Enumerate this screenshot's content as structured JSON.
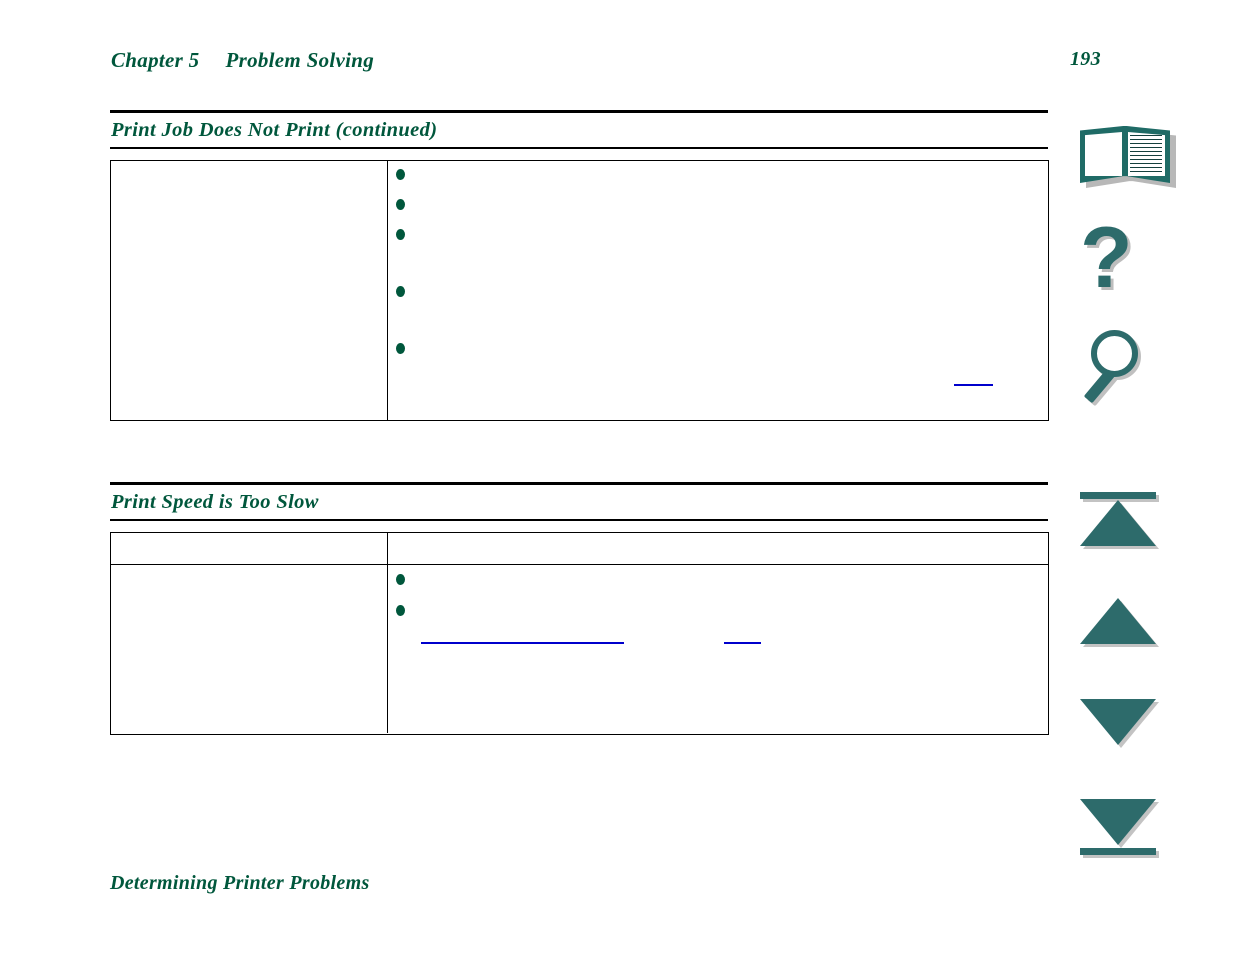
{
  "document": {
    "header": {
      "chapter_label": "Chapter 5",
      "chapter_title": "Problem Solving",
      "page_number": "193"
    },
    "footer": {
      "link_label": "Determining Printer Problems"
    },
    "sections": [
      {
        "id": "print-job-does-not-print",
        "title": "Print Job Does Not Print (continued)",
        "table": {
          "has_header_row": false,
          "left_column_cells": [
            ""
          ],
          "right_column_bullets": [
            "",
            "",
            "",
            "",
            ""
          ],
          "right_column_links": [
            ""
          ]
        }
      },
      {
        "id": "print-speed-is-too-slow",
        "title": "Print Speed is Too Slow",
        "table": {
          "has_header_row": true,
          "header_cells": [
            "",
            ""
          ],
          "left_column_cells": [
            ""
          ],
          "right_column_bullets": [
            "",
            ""
          ],
          "right_column_links": [
            "",
            ""
          ]
        }
      }
    ]
  },
  "nav_rail": {
    "buttons": [
      {
        "id": "contents",
        "icon": "book-icon",
        "label": "Contents"
      },
      {
        "id": "index",
        "icon": "question-mark-icon",
        "label": "Index / Help"
      },
      {
        "id": "search",
        "icon": "magnifier-icon",
        "label": "Search"
      },
      {
        "id": "first-page",
        "icon": "first-page-arrow-icon",
        "label": "First page"
      },
      {
        "id": "previous-page",
        "icon": "previous-page-arrow-icon",
        "label": "Previous page"
      },
      {
        "id": "next-page",
        "icon": "next-page-arrow-icon",
        "label": "Next page"
      },
      {
        "id": "last-page",
        "icon": "last-page-arrow-icon",
        "label": "Last page"
      }
    ]
  },
  "colors": {
    "heading_green": "#00573c",
    "bullet_green": "#00573c",
    "link_blue": "#0000cc",
    "icon_teal": "#2d6b6b",
    "rule_black": "#000000",
    "page_background": "#ffffff"
  }
}
